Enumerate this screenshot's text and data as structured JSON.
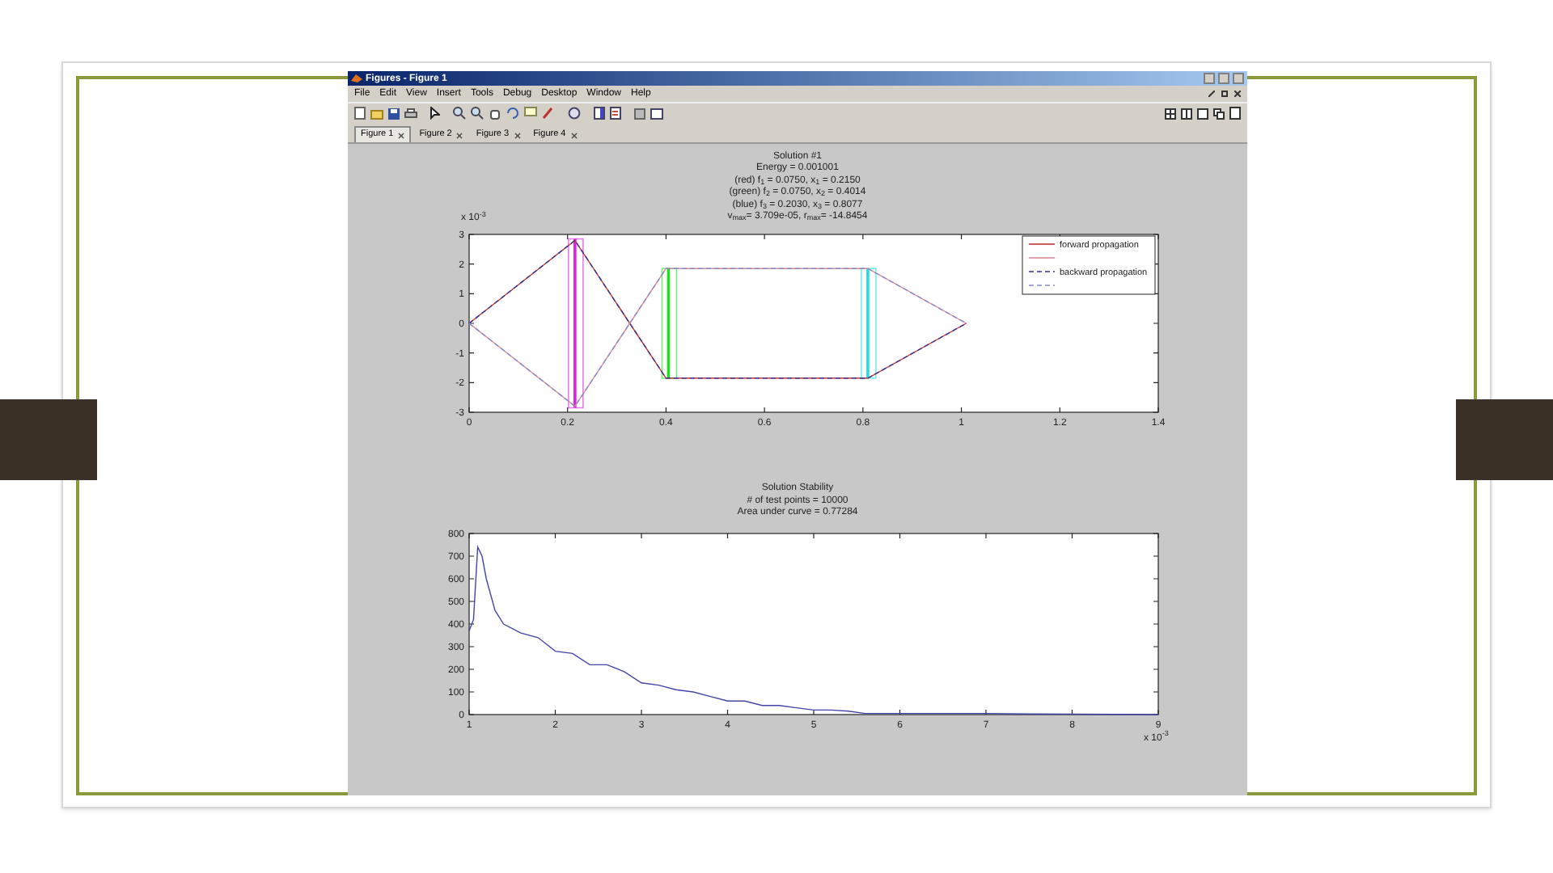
{
  "window": {
    "title": "Figures - Figure 1"
  },
  "menu": [
    "File",
    "Edit",
    "View",
    "Insert",
    "Tools",
    "Debug",
    "Desktop",
    "Window",
    "Help"
  ],
  "figure_tabs": [
    {
      "label": "Figure 1",
      "selected": true
    },
    {
      "label": "Figure 2",
      "selected": false
    },
    {
      "label": "Figure 3",
      "selected": false
    },
    {
      "label": "Figure 4",
      "selected": false
    }
  ],
  "plots": [
    {
      "titles": [
        "Solution #1",
        "Energy = 0.001001",
        "(red) f$_{1}$ = 0.0750, x$_{1}$ = 0.2150",
        "(green) f$_{2}$ = 0.0750, x$_{2}$ = 0.4014",
        "(blue) f$_{3}$ = 0.2030, x$_{3}$ = 0.8077",
        "v$_{max}$= 3.709e-05, r$_{max}$= -14.8454"
      ],
      "chart_data": {
        "type": "line",
        "ylabel": "x 10$^{-3}$",
        "x": [
          0,
          0.215,
          0.4,
          0.81,
          1.01
        ],
        "legend": "upper right",
        "series": [
          {
            "name": "forward propagation",
            "color": "#cc3333",
            "line_style": "solid",
            "values": [
              0,
              2.8,
              -1.85,
              -1.85,
              0
            ]
          },
          {
            "color": "#dd8899",
            "line_style": "solid",
            "values": [
              0,
              -2.8,
              1.85,
              1.85,
              0
            ]
          },
          {
            "name": "backward propagation",
            "color": "#333399",
            "line_style": "dashed",
            "values": [
              0,
              2.8,
              -1.85,
              -1.85,
              0
            ]
          },
          {
            "color": "#8888cc",
            "line_style": "dashed",
            "values": [
              0,
              -2.8,
              1.85,
              1.85,
              0
            ]
          }
        ],
        "xlim": [
          0,
          1.4
        ],
        "ylim": [
          -3,
          3
        ],
        "xticks": [
          {
            "value": 0,
            "label": "0"
          },
          {
            "value": 0.2,
            "label": "0.2"
          },
          {
            "value": 0.4,
            "label": "0.4"
          },
          {
            "value": 0.6,
            "label": "0.6"
          },
          {
            "value": 0.8,
            "label": "0.8"
          },
          {
            "value": 1,
            "label": "1"
          },
          {
            "value": 1.2,
            "label": "1.2"
          },
          {
            "value": 1.4,
            "label": "1.4"
          }
        ],
        "yticks": [
          -3,
          -2,
          -1,
          0,
          1,
          2,
          3
        ],
        "ref_lines": [
          {
            "axis": "x",
            "value": 0.215,
            "color": "#dd22dd"
          },
          {
            "axis": "x",
            "value": 0.405,
            "color": "#22dd22"
          },
          {
            "axis": "x",
            "value": 0.81,
            "color": "#22dddd"
          }
        ]
      }
    },
    {
      "titles": [
        "Solution Stability",
        "# of test points = 10000",
        "Area under curve = 0.77284"
      ],
      "chart_data": {
        "type": "line",
        "xlabel": "x 10$^{-3}$",
        "x": [
          1,
          1.05,
          1.1,
          1.15,
          1.2,
          1.3,
          1.4,
          1.6,
          1.8,
          2,
          2.2,
          2.4,
          2.6,
          2.8,
          3,
          3.2,
          3.4,
          3.6,
          3.8,
          4,
          4.2,
          4.4,
          4.6,
          4.8,
          5,
          5.2,
          5.4,
          5.6,
          6,
          6.5,
          7,
          7.5,
          8,
          8.5,
          9
        ],
        "series": [
          {
            "color": "#4444aa",
            "line_style": "solid",
            "values": [
              370,
              420,
              740,
              700,
              600,
              460,
              400,
              360,
              340,
              280,
              270,
              220,
              220,
              190,
              140,
              130,
              110,
              100,
              80,
              60,
              60,
              40,
              40,
              30,
              20,
              20,
              15,
              5,
              5,
              5,
              5,
              3,
              2,
              1,
              0
            ]
          }
        ],
        "xlim": [
          1,
          9
        ],
        "ylim": [
          0,
          800
        ],
        "xticks": [
          1,
          2,
          3,
          4,
          5,
          6,
          7,
          8,
          9
        ],
        "yticks": [
          0,
          100,
          200,
          300,
          400,
          500,
          600,
          700,
          800
        ]
      }
    }
  ]
}
